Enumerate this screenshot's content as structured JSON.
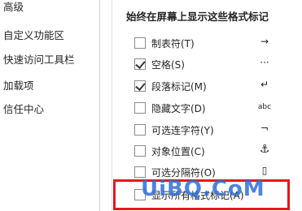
{
  "nav": {
    "items": [
      {
        "label": "高级"
      },
      {
        "label": "自定义功能区"
      },
      {
        "label": "快速访问工具栏"
      },
      {
        "label": "加载项"
      },
      {
        "label": "信任中心"
      }
    ]
  },
  "panel": {
    "section_title": "始终在屏幕上显示这些格式标记",
    "options": [
      {
        "label": "制表符(T)",
        "checked": false,
        "mark": "→",
        "mark_icon": "tab-arrow-icon"
      },
      {
        "label": "空格(S)",
        "checked": true,
        "mark": "···",
        "mark_icon": "space-dots-icon"
      },
      {
        "label": "段落标记(M)",
        "checked": true,
        "mark": "↵",
        "mark_icon": "paragraph-mark-icon"
      },
      {
        "label": "隐藏文字(D)",
        "checked": false,
        "mark": "abc",
        "mark_icon": "hidden-text-icon"
      },
      {
        "label": "可选连字符(Y)",
        "checked": false,
        "mark": "¬",
        "mark_icon": "optional-hyphen-icon"
      },
      {
        "label": "对象位置(C)",
        "checked": false,
        "mark": "⚓",
        "mark_icon": "anchor-icon"
      },
      {
        "label": "可选分隔符(O)",
        "checked": false,
        "mark": "▯",
        "mark_icon": "separator-icon"
      },
      {
        "label": "显示所有格式标记(A)",
        "checked": false,
        "mark": "",
        "mark_icon": ""
      }
    ]
  },
  "watermark": {
    "text": "UiBQ.CoM",
    "color": "#2f6fd6"
  },
  "highlight": {
    "color": "#e8161c"
  }
}
